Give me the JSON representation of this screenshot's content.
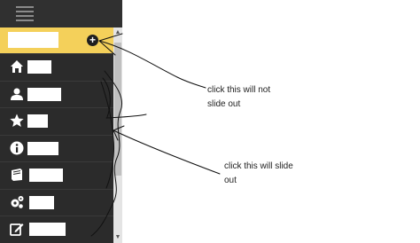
{
  "sidebar": {
    "toggle_icon": "hamburger-menu-icon",
    "header_action_icon": "plus-circle-icon",
    "items": [
      {
        "icon": "home-icon"
      },
      {
        "icon": "user-icon"
      },
      {
        "icon": "star-icon"
      },
      {
        "icon": "info-icon"
      },
      {
        "icon": "book-icon"
      },
      {
        "icon": "gears-icon"
      },
      {
        "icon": "edit-icon"
      }
    ]
  },
  "annotations": {
    "no_slide": "click this will not slide out",
    "slide": "click this will slide out"
  },
  "colors": {
    "sidebar_bg": "#2b2b2b",
    "header_accent": "#f4d05a"
  }
}
